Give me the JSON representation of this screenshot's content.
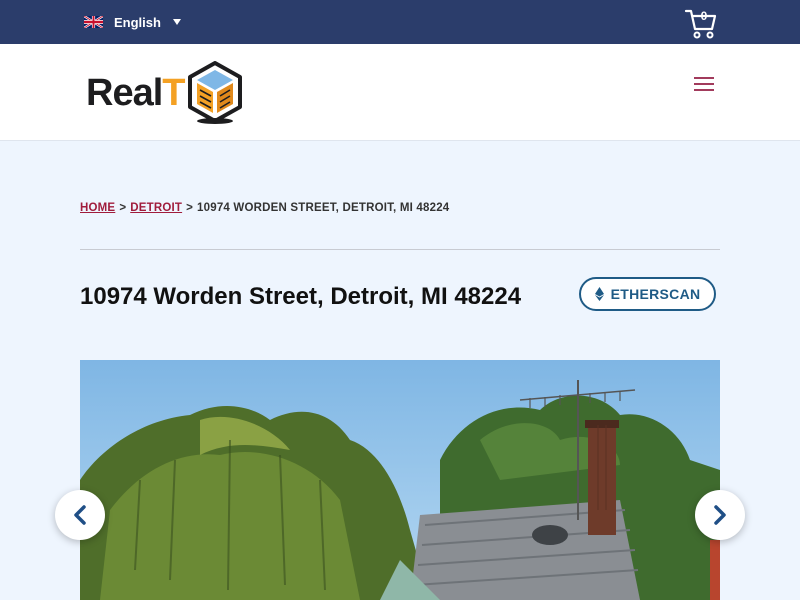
{
  "topbar": {
    "language": "English",
    "flag_icon": "uk-flag-icon",
    "cart_icon": "cart-icon",
    "cart_count": "0"
  },
  "header": {
    "logo_text_main": "Real",
    "logo_text_accent": "T",
    "menu_icon": "hamburger-icon"
  },
  "breadcrumb": {
    "home": "HOME",
    "city": "DETROIT",
    "separator": ">",
    "current": "10974 WORDEN STREET, DETROIT, MI 48224"
  },
  "property": {
    "title": "10974 Worden Street, Detroit, MI 48224",
    "etherscan_label": "ETHERSCAN"
  },
  "gallery": {
    "prev_icon": "chevron-left-icon",
    "next_icon": "chevron-right-icon"
  },
  "colors": {
    "topbar": "#2b3d6b",
    "accent_link": "#a01c3c",
    "logo_orange": "#f4a124",
    "etherscan_blue": "#1f5b86",
    "page_bg": "#eef5fe"
  }
}
